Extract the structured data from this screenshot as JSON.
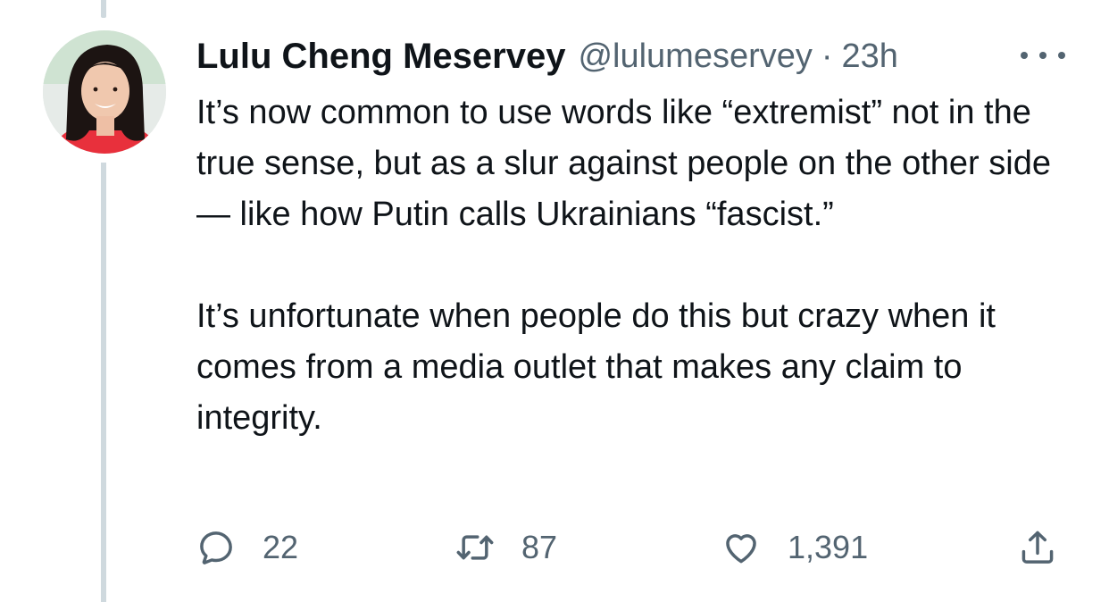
{
  "tweet": {
    "display_name": "Lulu Cheng Meservey",
    "handle": "@lulumeservey",
    "separator": "·",
    "time": "23h",
    "paragraphs": [
      "It’s now common to use words like “extremist” not in the true sense, but as a slur against people on the other side — like how Putin calls Ukrainians “fascist.”",
      "It’s unfortunate when people do this but crazy when it comes from a media outlet that makes any claim to integrity."
    ],
    "actions": {
      "reply_count": "22",
      "retweet_count": "87",
      "like_count": "1,391"
    }
  },
  "icons": {
    "more": "more-horizontal-icon",
    "reply": "reply-bubble-icon",
    "retweet": "retweet-icon",
    "like": "heart-icon",
    "share": "share-upload-icon"
  },
  "colors": {
    "text_primary": "#0f1419",
    "text_secondary": "#536471",
    "thread_line": "#cfd9de"
  }
}
